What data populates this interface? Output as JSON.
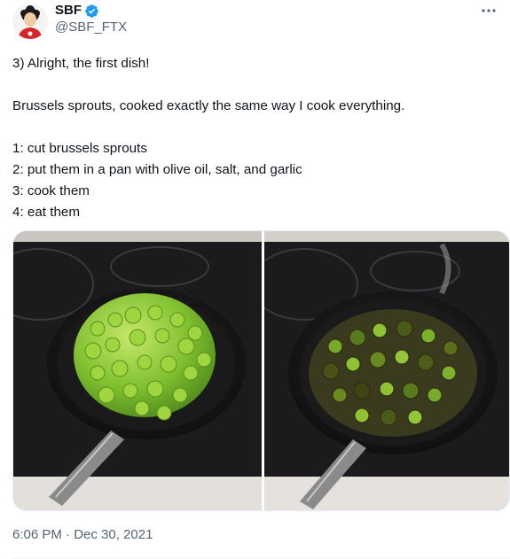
{
  "author": {
    "name": "SBF",
    "handle": "@SBF_FTX",
    "verified_color": "#1d9bf0"
  },
  "tweet": {
    "lines": [
      "3) Alright, the first dish!",
      "",
      "Brussels sprouts, cooked exactly the same way I cook everything.",
      "",
      "1: cut brussels sprouts",
      "2: put them in a pan with olive oil, salt, and garlic",
      "3: cook them",
      "4: eat them"
    ],
    "time": "6:06 PM",
    "separator": "·",
    "date": "Dec 30, 2021"
  },
  "media": {
    "photos": [
      {
        "subject": "raw-brussels-sprouts-in-pan"
      },
      {
        "subject": "cooked-brussels-sprouts-in-pan"
      }
    ]
  },
  "icons": {
    "more": "more-icon",
    "verified": "verified-badge-icon"
  }
}
